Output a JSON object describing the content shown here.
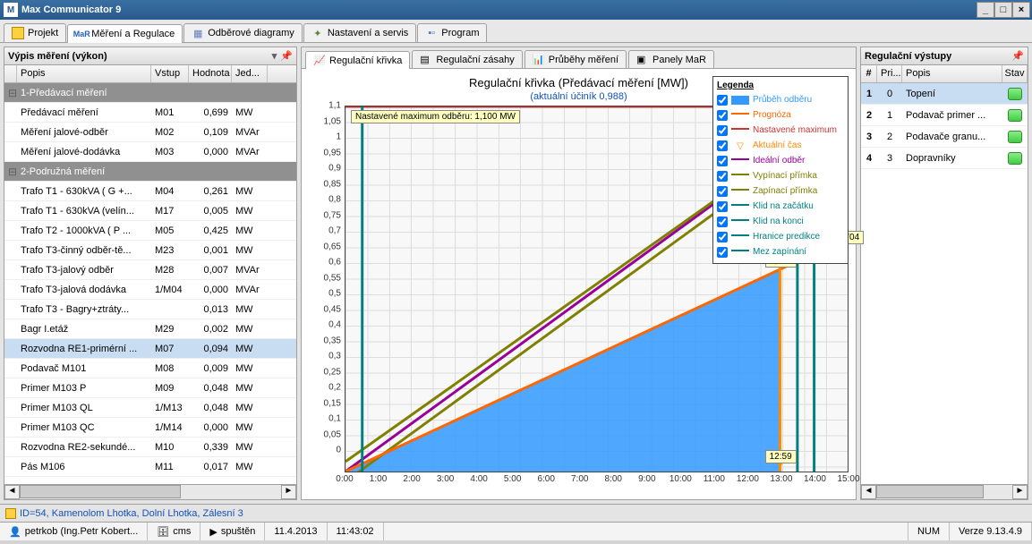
{
  "window": {
    "title": "Max Communicator 9"
  },
  "main_tabs": [
    {
      "label": "Projekt",
      "icon": "square-yellow"
    },
    {
      "label": "Měření a Regulace",
      "icon": "mar-blue",
      "active": true
    },
    {
      "label": "Odběrové diagramy",
      "icon": "grid"
    },
    {
      "label": "Nastavení a servis",
      "icon": "gear"
    },
    {
      "label": "Program",
      "icon": "chart"
    }
  ],
  "left_panel": {
    "title": "Výpis měření (výkon)",
    "columns": {
      "popis": "Popis",
      "vstup": "Vstup",
      "hodnota": "Hodnota",
      "jed": "Jed..."
    },
    "rows": [
      {
        "group": true,
        "popis": "1-Předávací měření"
      },
      {
        "popis": "Předávací měření",
        "vstup": "M01",
        "hodnota": "0,699",
        "jed": "MW"
      },
      {
        "popis": "Měření jalové-odběr",
        "vstup": "M02",
        "hodnota": "0,109",
        "jed": "MVAr"
      },
      {
        "popis": "Měření jalové-dodávka",
        "vstup": "M03",
        "hodnota": "0,000",
        "jed": "MVAr"
      },
      {
        "group": true,
        "popis": "2-Podružná měření"
      },
      {
        "popis": "Trafo T1 - 630kVA ( G +...",
        "vstup": "M04",
        "hodnota": "0,261",
        "jed": "MW"
      },
      {
        "popis": "Trafo T1 - 630kVA (velín...",
        "vstup": "M17",
        "hodnota": "0,005",
        "jed": "MW"
      },
      {
        "popis": "Trafo T2 - 1000kVA ( P ...",
        "vstup": "M05",
        "hodnota": "0,425",
        "jed": "MW"
      },
      {
        "popis": "Trafo T3-činný odběr-tě...",
        "vstup": "M23",
        "hodnota": "0,001",
        "jed": "MW"
      },
      {
        "popis": "Trafo T3-jalový odběr",
        "vstup": "M28",
        "hodnota": "0,007",
        "jed": "MVAr"
      },
      {
        "popis": "Trafo T3-jalová dodávka",
        "vstup": "1/M04",
        "hodnota": "0,000",
        "jed": "MVAr"
      },
      {
        "popis": "Trafo T3 - Bagry+ztráty...",
        "vstup": "",
        "hodnota": "0,013",
        "jed": "MW"
      },
      {
        "popis": "Bagr I.etáž",
        "vstup": "M29",
        "hodnota": "0,002",
        "jed": "MW"
      },
      {
        "popis": "Rozvodna RE1-primérní ...",
        "vstup": "M07",
        "hodnota": "0,094",
        "jed": "MW",
        "selected": true
      },
      {
        "popis": "Podavač M101",
        "vstup": "M08",
        "hodnota": "0,009",
        "jed": "MW"
      },
      {
        "popis": "Primer M103 P",
        "vstup": "M09",
        "hodnota": "0,048",
        "jed": "MW"
      },
      {
        "popis": "Primer M103 QL",
        "vstup": "1/M13",
        "hodnota": "0,048",
        "jed": "MW"
      },
      {
        "popis": "Primer M103 QC",
        "vstup": "1/M14",
        "hodnota": "0,000",
        "jed": "MW"
      },
      {
        "popis": "Rozvodna RE2-sekundé...",
        "vstup": "M10",
        "hodnota": "0,339",
        "jed": "MW"
      },
      {
        "popis": "Pás M106",
        "vstup": "M11",
        "hodnota": "0,017",
        "jed": "MW"
      }
    ]
  },
  "sub_tabs": [
    {
      "label": "Regulační křivka",
      "active": true
    },
    {
      "label": "Regulační zásahy"
    },
    {
      "label": "Průběhy měření"
    },
    {
      "label": "Panely MaR"
    }
  ],
  "chart": {
    "title": "Regulační křivka (Předávací měření [MW])",
    "subtitle": "(aktuální účiník 0,988)",
    "max_label": "Nastavené maximum odběru: 1,100 MW",
    "value_right": "0,704",
    "value_peak": "0,610",
    "time_marker": "12:59"
  },
  "chart_data": {
    "type": "line",
    "xlabel": "",
    "ylabel": "",
    "ylim": [
      0,
      1.1
    ],
    "x_ticks": [
      "0:00",
      "1:00",
      "2:00",
      "3:00",
      "4:00",
      "5:00",
      "6:00",
      "7:00",
      "8:00",
      "9:00",
      "10:00",
      "11:00",
      "12:00",
      "13:00",
      "14:00",
      "15:00"
    ],
    "y_ticks": [
      0,
      0.05,
      0.1,
      0.15,
      0.2,
      0.25,
      0.3,
      0.35,
      0.4,
      0.45,
      0.5,
      0.55,
      0.6,
      0.65,
      0.7,
      0.75,
      0.8,
      0.85,
      0.9,
      0.95,
      1.0,
      1.05,
      1.1
    ],
    "series": {
      "prubeh_odberu": {
        "name": "Průběh odběru",
        "color": "#3399ff",
        "x_end": 13.0,
        "y_end": 0.61
      },
      "prognoza": {
        "name": "Prognóza",
        "color": "#ff6600",
        "x_end": 15.0,
        "y_end": 0.704
      },
      "nastavene_maximum": {
        "name": "Nastavené maximum",
        "color": "#cc3333",
        "y": 1.1
      },
      "aktualni_cas": {
        "name": "Aktuální čas",
        "x": 12.98
      },
      "idealni_odber": {
        "name": "Ideální odběr",
        "color": "#990099",
        "end_y": 1.1
      },
      "vypinaci": {
        "name": "Vypínací přímka",
        "color": "#808000",
        "end_y": 1.1
      },
      "zapinaci": {
        "name": "Zapínací přímka",
        "color": "#808000",
        "end_y": 1.1
      },
      "klid_zacatek": {
        "name": "Klid na začátku",
        "color": "#008080",
        "x": 0.5
      },
      "klid_konec": {
        "name": "Klid na konci",
        "color": "#008080",
        "x": 14.0
      },
      "hranice_predikce": {
        "name": "Hranice predikce",
        "color": "#008080",
        "x": 13.5
      },
      "mez_zapinani": {
        "name": "Mez zapínání",
        "color": "#008080"
      }
    }
  },
  "legend": {
    "title": "Legenda",
    "items": [
      {
        "label": "Průběh odběru",
        "color": "#3399ff",
        "fill": true
      },
      {
        "label": "Prognóza",
        "color": "#ff6600"
      },
      {
        "label": "Nastavené maximum",
        "color": "#cc3333"
      },
      {
        "label": "Aktuální čas",
        "color": "#ff8800",
        "triangle": true
      },
      {
        "label": "Ideální odběr",
        "color": "#990099"
      },
      {
        "label": "Vypínací přímka",
        "color": "#808000"
      },
      {
        "label": "Zapínací přímka",
        "color": "#808000"
      },
      {
        "label": "Klid na začátku",
        "color": "#008080"
      },
      {
        "label": "Klid na konci",
        "color": "#008080"
      },
      {
        "label": "Hranice predikce",
        "color": "#008080"
      },
      {
        "label": "Mez zapínání",
        "color": "#008080"
      }
    ]
  },
  "right_panel": {
    "title": "Regulační výstupy",
    "columns": {
      "num": "#",
      "pri": "Pri...",
      "popis": "Popis",
      "stav": "Stav"
    },
    "rows": [
      {
        "num": "1",
        "pri": "0",
        "popis": "Topení",
        "selected": true
      },
      {
        "num": "2",
        "pri": "1",
        "popis": "Podavač primer ..."
      },
      {
        "num": "3",
        "pri": "2",
        "popis": "Podavače granu..."
      },
      {
        "num": "4",
        "pri": "3",
        "popis": "Dopravníky"
      }
    ]
  },
  "idbar": {
    "text": "ID=54, Kamenolom Lhotka, Dolní Lhotka, Zálesní 3"
  },
  "statusbar": {
    "user": "petrkob (Ing.Petr Kobert...",
    "db": "cms",
    "state": "spuštěn",
    "date": "11.4.2013",
    "time": "11:43:02",
    "num": "NUM",
    "version": "Verze 9.13.4.9"
  }
}
